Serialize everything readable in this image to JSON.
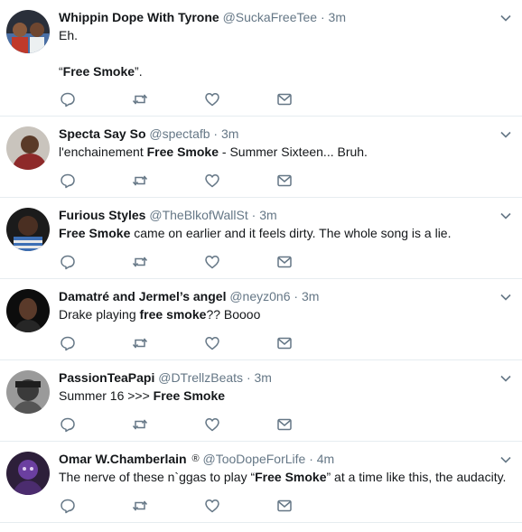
{
  "colors": {
    "action_icon": "#657786",
    "divider": "#e6ecf0",
    "text": "#14171a",
    "muted": "#657786"
  },
  "tweets": [
    {
      "name": "Whippin Dope With Tyrone",
      "handle": "@SuckaFreeTee",
      "sep": "·",
      "time": "3m",
      "verified": "",
      "lines": [
        [
          {
            "t": "Eh.",
            "b": false
          }
        ],
        [],
        [
          {
            "t": "“",
            "b": false
          },
          {
            "t": "Free Smoke",
            "b": true
          },
          {
            "t": "”.",
            "b": false
          }
        ]
      ],
      "avatar": "avatar-photo",
      "icons": [
        "reply-icon",
        "retweet-icon",
        "like-icon",
        "message-icon"
      ]
    },
    {
      "name": "Specta Say So",
      "handle": "@spectafb",
      "sep": "·",
      "time": "3m",
      "verified": "",
      "lines": [
        [
          {
            "t": "l'enchainement ",
            "b": false
          },
          {
            "t": "Free Smoke",
            "b": true
          },
          {
            "t": " - Summer Sixteen... Bruh.",
            "b": false
          }
        ]
      ],
      "avatar": "avatar-photo",
      "icons": [
        "reply-icon",
        "retweet-icon",
        "like-icon",
        "message-icon"
      ]
    },
    {
      "name": "Furious Styles",
      "handle": "@TheBlkofWallSt",
      "sep": "·",
      "time": "3m",
      "verified": "",
      "lines": [
        [
          {
            "t": "Free Smoke",
            "b": true
          },
          {
            "t": " came on earlier and it feels dirty. The whole song is a lie.",
            "b": false
          }
        ]
      ],
      "avatar": "avatar-photo",
      "icons": [
        "reply-icon",
        "retweet-icon",
        "like-icon",
        "message-icon"
      ]
    },
    {
      "name": "Damatré and Jermel’s angel",
      "handle": "@neyz0n6",
      "sep": "·",
      "time": "3m",
      "verified": "",
      "lines": [
        [
          {
            "t": "Drake playing ",
            "b": false
          },
          {
            "t": "free smoke",
            "b": true
          },
          {
            "t": "?? Boooo",
            "b": false
          }
        ]
      ],
      "avatar": "avatar-photo",
      "icons": [
        "reply-icon",
        "retweet-icon",
        "like-icon",
        "message-icon"
      ]
    },
    {
      "name": "PassionTeaPapi",
      "handle": "@DTrellzBeats",
      "sep": "·",
      "time": "3m",
      "verified": "",
      "lines": [
        [
          {
            "t": "Summer 16 >>> ",
            "b": false
          },
          {
            "t": "Free Smoke",
            "b": true
          }
        ]
      ],
      "avatar": "avatar-photo",
      "icons": [
        "reply-icon",
        "retweet-icon",
        "like-icon",
        "message-icon"
      ]
    },
    {
      "name": "Omar W.Chamberlain",
      "handle": "@TooDopeForLife",
      "sep": "·",
      "time": "4m",
      "verified": "®",
      "lines": [
        [
          {
            "t": "The nerve of these n`ggas to play “",
            "b": false
          },
          {
            "t": "Free Smoke",
            "b": true
          },
          {
            "t": "” at a time like this, the audacity.",
            "b": false
          }
        ]
      ],
      "avatar": "avatar-photo",
      "icons": [
        "reply-icon",
        "retweet-icon",
        "like-icon",
        "message-icon"
      ]
    }
  ]
}
